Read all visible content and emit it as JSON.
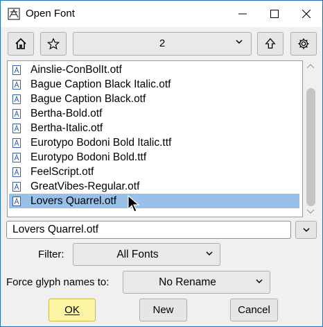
{
  "window": {
    "title": "Open Font"
  },
  "toolbar": {
    "directory": "2"
  },
  "files": [
    {
      "name": "Ainslie-ConBolIt.otf",
      "selected": false
    },
    {
      "name": "Bague Caption Black Italic.otf",
      "selected": false
    },
    {
      "name": "Bague Caption Black.otf",
      "selected": false
    },
    {
      "name": "Bertha-Bold.otf",
      "selected": false
    },
    {
      "name": "Bertha-Italic.otf",
      "selected": false
    },
    {
      "name": "Eurotypo Bodoni Bold Italic.ttf",
      "selected": false
    },
    {
      "name": "Eurotypo Bodoni Bold.ttf",
      "selected": false
    },
    {
      "name": "FeelScript.otf",
      "selected": false
    },
    {
      "name": "GreatVibes-Regular.otf",
      "selected": false
    },
    {
      "name": "Lovers Quarrel.otf",
      "selected": true
    }
  ],
  "filename": {
    "value": "Lovers Quarrel.otf"
  },
  "filter": {
    "label": "Filter:",
    "value": "All Fonts"
  },
  "rename": {
    "label": "Force glyph names to:",
    "value": "No Rename"
  },
  "buttons": {
    "ok": "OK",
    "new": "New",
    "cancel": "Cancel"
  },
  "colors": {
    "selection": "#99c0e8",
    "ok_button": "#fbf5a4",
    "window_border": "#1f6fbf"
  }
}
